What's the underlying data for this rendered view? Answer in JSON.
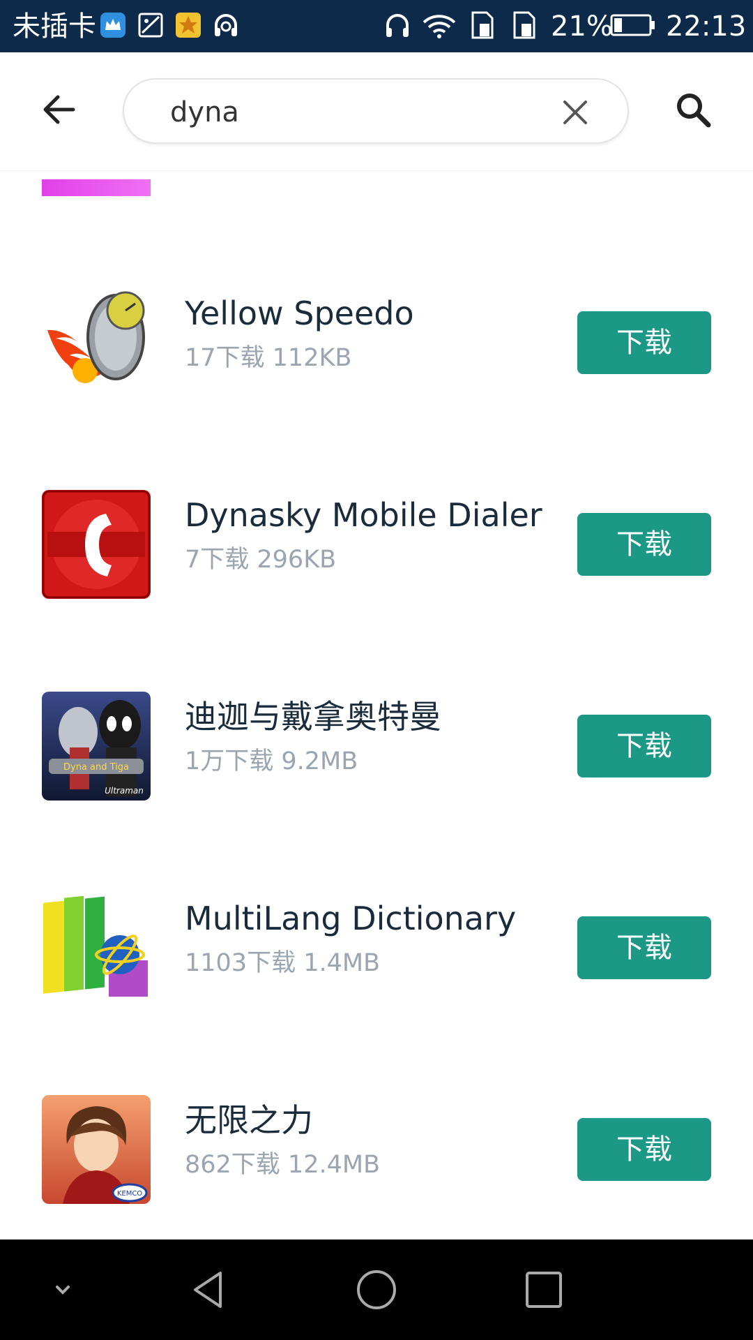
{
  "status_bar": {
    "carrier": "未插卡",
    "battery_percent": "21%",
    "time": "22:13",
    "icons": [
      "crown-icon",
      "image-icon",
      "star-badge-icon",
      "music-headset-icon",
      "headphones-icon",
      "wifi-icon",
      "sim-card-icon",
      "sim-card-icon",
      "battery-icon"
    ]
  },
  "search": {
    "value": "dyna"
  },
  "results": [
    {
      "name": "Yellow Speedo",
      "meta": "17下载 112KB",
      "button": "下载",
      "icon": "speedometer-flame-icon"
    },
    {
      "name": "Dynasky Mobile Dialer",
      "meta": "7下载 296KB",
      "button": "下载",
      "icon": "red-phone-icon"
    },
    {
      "name": "迪迦与戴拿奥特曼",
      "meta": "1万下载 9.2MB",
      "button": "下载",
      "icon": "ultraman-icon",
      "icon_text": [
        "Dyna and Tiga",
        "Ultraman"
      ]
    },
    {
      "name": "MultiLang Dictionary",
      "meta": "1103下载 1.4MB",
      "button": "下载",
      "icon": "books-globe-icon"
    },
    {
      "name": "无限之力",
      "meta": "862下载 12.4MB",
      "button": "下载",
      "icon": "anime-hero-icon",
      "icon_text": [
        "KEMCO"
      ]
    }
  ],
  "colors": {
    "status_bar_bg": "#0d2a4a",
    "download_button": "#1b9886",
    "title_text": "#1a2b3c",
    "meta_text": "#9aa5b0"
  }
}
